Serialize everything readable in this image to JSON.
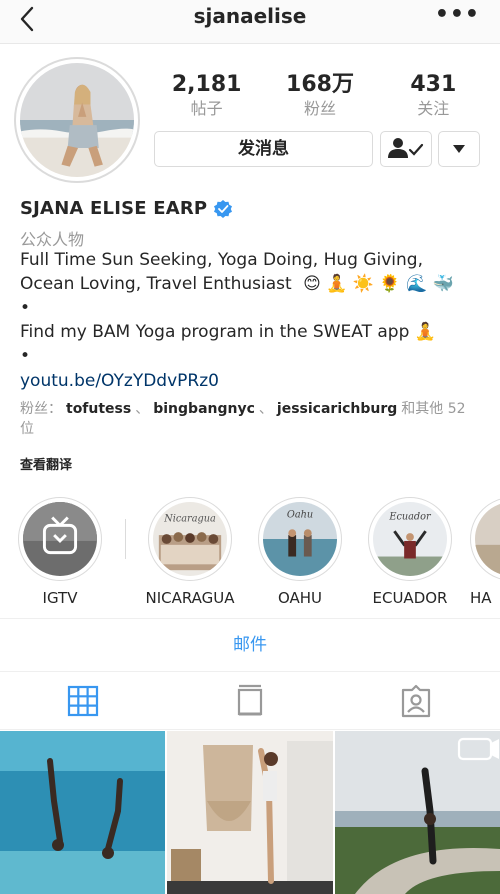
{
  "nav": {
    "title": "sjanaelise",
    "more": "•••"
  },
  "stats": [
    {
      "value": "2,181",
      "label": "帖子"
    },
    {
      "value": "168万",
      "label": "粉丝"
    },
    {
      "value": "431",
      "label": "关注"
    }
  ],
  "actions": {
    "message": "发消息"
  },
  "profile": {
    "name": "SJANA ELISE EARP",
    "category": "公众人物",
    "bio_line1": "Full Time Sun Seeking, Yoga Doing, Hug Giving,",
    "bio_line2": "Ocean Loving, Travel Enthusiast",
    "bio_emojis2": "😊 🧘 ☀️ 🌻 🌊 🐳",
    "bio_dot": "•",
    "bio_line3": "Find my BAM Yoga program in the SWEAT app 🧘",
    "link": "youtu.be/OYzYDdvPRz0",
    "followers_prefix": "粉丝：",
    "followers": [
      "tofutess",
      "bingbangnyc",
      "jessicarichburg"
    ],
    "followers_sep": "、",
    "followers_suffix": "和其他 52 位",
    "translate": "查看翻译"
  },
  "highlights": [
    {
      "label": "IGTV",
      "icon": "igtv-icon"
    },
    {
      "label": "NICARAGUA",
      "caption": "Nicaragua"
    },
    {
      "label": "OAHU",
      "caption": "Oahu"
    },
    {
      "label": "ECUADOR",
      "caption": "Ecuador"
    },
    {
      "label": "HA"
    }
  ],
  "email": "邮件",
  "tabs": [
    {
      "name": "grid-tab",
      "icon": "grid-icon",
      "active": true
    },
    {
      "name": "igtv-tab",
      "icon": "tv-icon",
      "active": false
    },
    {
      "name": "tagged-tab",
      "icon": "tagged-icon",
      "active": false
    }
  ],
  "colors": {
    "link": "#003569",
    "accent": "#3897f0",
    "muted": "#999999",
    "verified": "#3897f0"
  }
}
